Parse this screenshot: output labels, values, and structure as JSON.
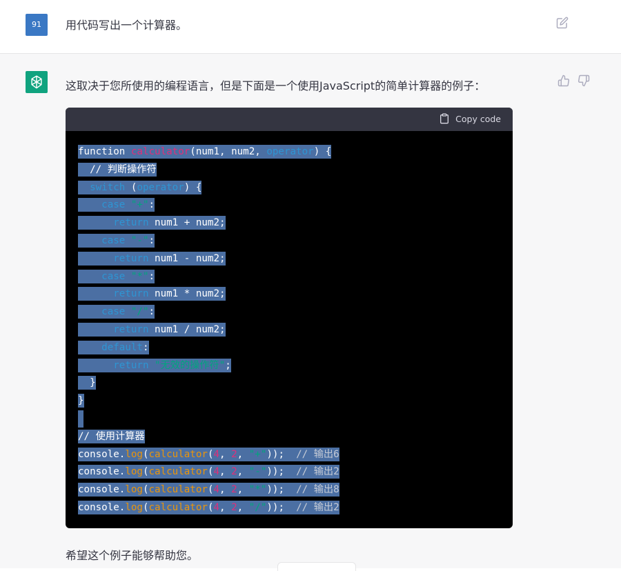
{
  "user": {
    "avatar_text": "91",
    "message": "用代码写出一个计算器。"
  },
  "assistant": {
    "intro": "这取决于您所使用的编程语言，但是下面是一个使用JavaScript的简单计算器的例子：",
    "closing": "希望这个例子能够帮助您。",
    "brand_color": "#10a37f"
  },
  "code_block": {
    "copy_label": "Copy code",
    "lines": {
      "l1a": "function ",
      "l1b": "calculator",
      "l1c": "(num1, num2, ",
      "l1d": "operator",
      "l1e": ") {",
      "l2": "  // 判断操作符",
      "l3a": "  switch",
      "l3b": " (",
      "l3c": "operator",
      "l3d": ") {",
      "l4a": "    case ",
      "l4b": "\"+\"",
      "l4c": ":",
      "l5a": "      return",
      "l5b": " num1 + num2;",
      "l6a": "    case ",
      "l6b": "\"-\"",
      "l6c": ":",
      "l7a": "      return",
      "l7b": " num1 - num2;",
      "l8a": "    case ",
      "l8b": "\"*\"",
      "l8c": ":",
      "l9a": "      return",
      "l9b": " num1 * num2;",
      "l10a": "    case ",
      "l10b": "\"/\"",
      "l10c": ":",
      "l11a": "      return",
      "l11b": " num1 / num2;",
      "l12a": "    default",
      "l12b": ":",
      "l13a": "      return",
      "l13b": " \"无效的操作符\"",
      "l13c": ";",
      "l14": "  }",
      "l15": "}",
      "l17": "// 使用计算器",
      "c1": {
        "a": "console.",
        "b": "log",
        "c": "(",
        "d": "calculator",
        "e": "(",
        "f": "4",
        "g": ", ",
        "h": "2",
        "i": ", ",
        "j": "\"+\"",
        "k": "));  ",
        "l": "// 输出6"
      },
      "c2": {
        "a": "console.",
        "b": "log",
        "c": "(",
        "d": "calculator",
        "e": "(",
        "f": "4",
        "g": ", ",
        "h": "2",
        "i": ", ",
        "j": "\"-\"",
        "k": "));  ",
        "l": "// 输出2"
      },
      "c3": {
        "a": "console.",
        "b": "log",
        "c": "(",
        "d": "calculator",
        "e": "(",
        "f": "4",
        "g": ", ",
        "h": "2",
        "i": ", ",
        "j": "\"*\"",
        "k": "));  ",
        "l": "// 输出8"
      },
      "c4": {
        "a": "console.",
        "b": "log",
        "c": "(",
        "d": "calculator",
        "e": "(",
        "f": "4",
        "g": ", ",
        "h": "2",
        "i": ", ",
        "j": "\"/\"",
        "k": "));  ",
        "l": "// 输出2"
      }
    }
  },
  "icons": {
    "edit": "edit-icon",
    "thumbs_up": "thumbs-up-icon",
    "thumbs_down": "thumbs-down-icon",
    "clipboard": "clipboard-icon",
    "openai": "openai-logo-icon"
  }
}
